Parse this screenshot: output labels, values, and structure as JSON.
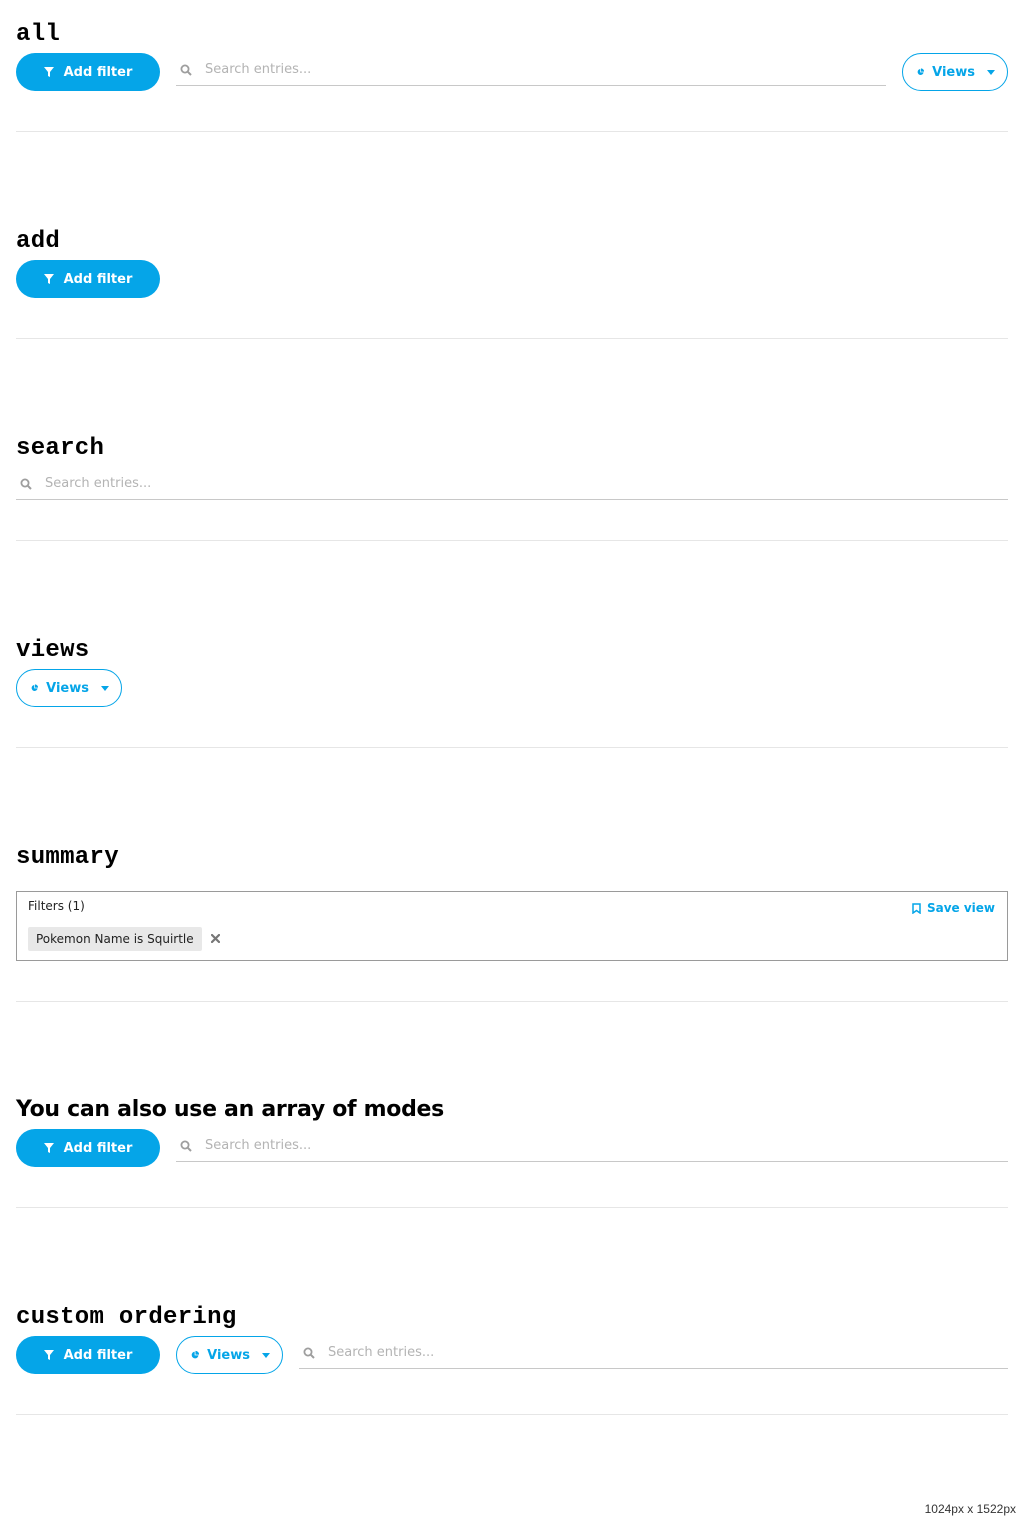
{
  "colors": {
    "accent": "#05a5e8",
    "divider": "#e6e6e6",
    "chip_bg": "#e8e8e8"
  },
  "sections": {
    "all": {
      "title": "all",
      "add_filter_label": "Add filter",
      "search_placeholder": "Search entries...",
      "views_label": "Views"
    },
    "add": {
      "title": "add",
      "add_filter_label": "Add filter"
    },
    "search": {
      "title": "search",
      "search_placeholder": "Search entries..."
    },
    "views": {
      "title": "views",
      "views_label": "Views"
    },
    "summary": {
      "title": "summary",
      "filters_heading": "Filters (1)",
      "save_view_label": "Save view",
      "chip_label": "Pokemon Name is Squirtle"
    },
    "array_modes": {
      "title": "You can also use an array of modes",
      "add_filter_label": "Add filter",
      "search_placeholder": "Search entries..."
    },
    "custom_ordering": {
      "title": "custom ordering",
      "add_filter_label": "Add filter",
      "views_label": "Views",
      "search_placeholder": "Search entries..."
    }
  },
  "icons": {
    "filter": "filter-icon",
    "search": "search-icon",
    "views": "pie-chart-icon",
    "caret": "caret-down-icon",
    "bookmark": "bookmark-icon",
    "close": "close-icon"
  },
  "viewport_label": "1024px x 1522px"
}
